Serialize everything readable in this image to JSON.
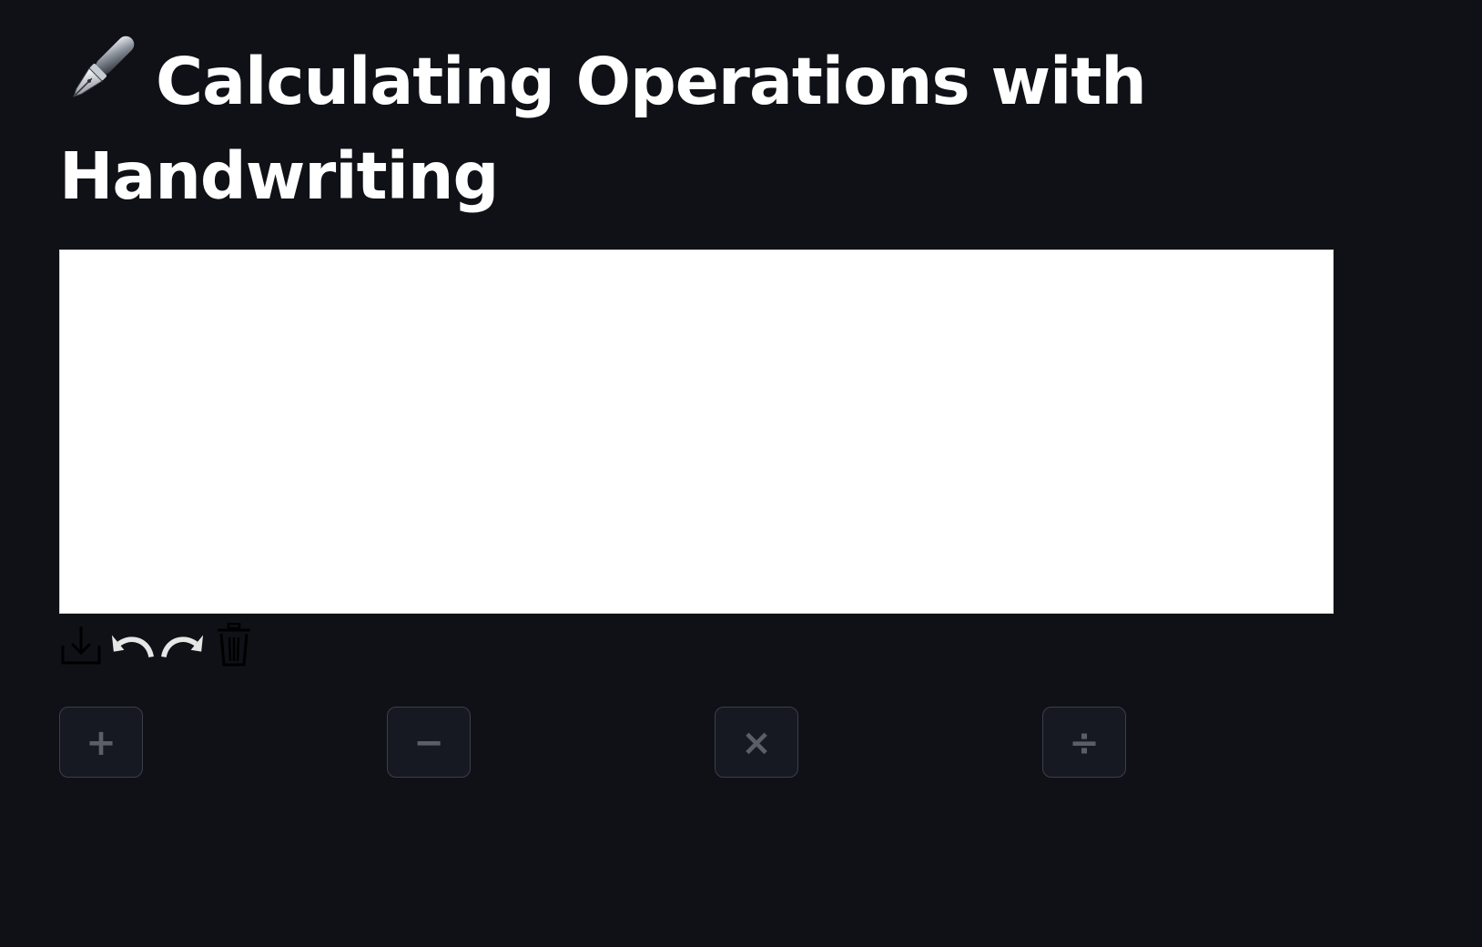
{
  "header": {
    "title": "Calculating Operations with Handwriting",
    "title_icon": "fountain-pen-icon"
  },
  "canvas": {
    "background": "#ffffff",
    "toolbar": [
      {
        "name": "download-icon"
      },
      {
        "name": "undo-icon"
      },
      {
        "name": "redo-icon"
      },
      {
        "name": "trash-icon"
      }
    ]
  },
  "operations": {
    "add_label": "+",
    "subtract_label": "−",
    "multiply_label": "×",
    "divide_label": "÷"
  },
  "colors": {
    "background": "#0f1117",
    "title_text": "#ffffff",
    "button_border": "#3c3f4a",
    "button_text": "#5b5e66"
  }
}
